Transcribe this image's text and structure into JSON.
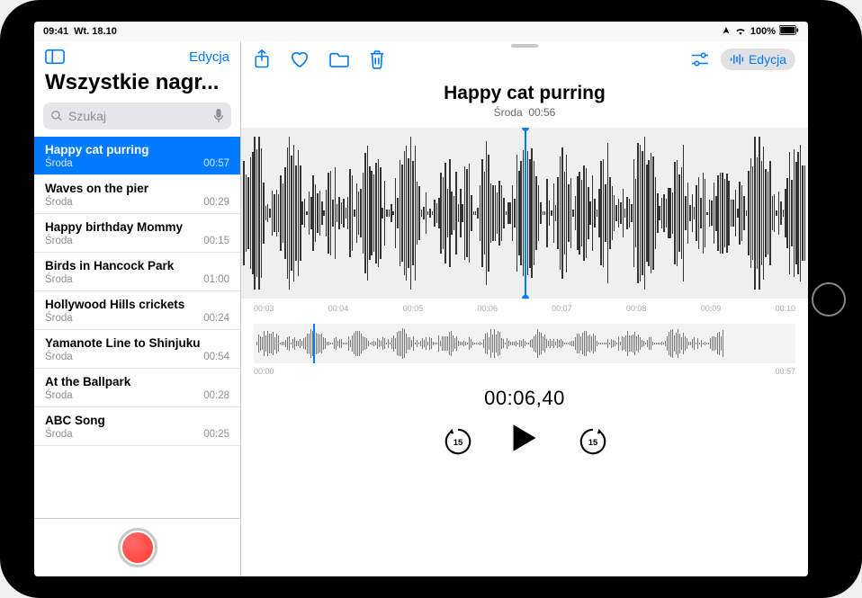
{
  "status": {
    "time": "09:41",
    "date": "Wt. 18.10",
    "battery": "100%"
  },
  "sidebar": {
    "edit_label": "Edycja",
    "title": "Wszystkie nagr...",
    "search_placeholder": "Szukaj",
    "items": [
      {
        "title": "Happy cat purring",
        "day": "Środa",
        "duration": "00:57",
        "selected": true
      },
      {
        "title": "Waves on the pier",
        "day": "Środa",
        "duration": "00:29",
        "selected": false
      },
      {
        "title": "Happy birthday Mommy",
        "day": "Środa",
        "duration": "00:15",
        "selected": false
      },
      {
        "title": "Birds in Hancock Park",
        "day": "Środa",
        "duration": "01:00",
        "selected": false
      },
      {
        "title": "Hollywood Hills crickets",
        "day": "Środa",
        "duration": "00:24",
        "selected": false
      },
      {
        "title": "Yamanote Line to Shinjuku",
        "day": "Środa",
        "duration": "00:54",
        "selected": false
      },
      {
        "title": "At the Ballpark",
        "day": "Środa",
        "duration": "00:28",
        "selected": false
      },
      {
        "title": "ABC Song",
        "day": "Środa",
        "duration": "00:25",
        "selected": false
      }
    ]
  },
  "main": {
    "edit_label": "Edycja",
    "title": "Happy cat purring",
    "subtitle_day": "Środa",
    "subtitle_duration": "00:56",
    "zoom_ticks": [
      "00:03",
      "00:04",
      "00:05",
      "00:06",
      "00:07",
      "00:08",
      "00:09",
      "00:10"
    ],
    "full_ticks": [
      "00:00",
      "00:57"
    ],
    "timecode": "00:06,40",
    "skip_seconds": "15"
  },
  "colors": {
    "accent": "#007AFF",
    "record": "#FF3B30"
  }
}
